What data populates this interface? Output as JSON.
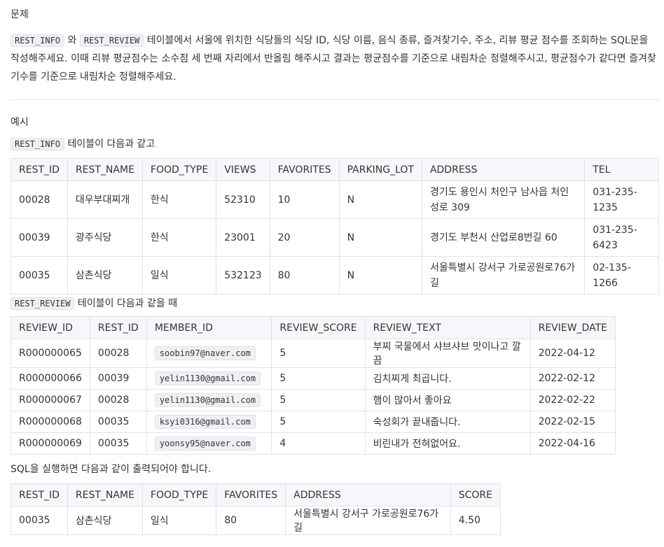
{
  "heading": "문제",
  "description": {
    "code1": "REST_INFO",
    "conj": " 와 ",
    "code2": "REST_REVIEW",
    "text": " 테이블에서 서울에 위치한 식당들의 식당 ID, 식당 이름, 음식 종류, 즐겨찾기수, 주소, 리뷰 평균 점수를 조회하는 SQL문을 작성해주세요. 이때 리뷰 평균점수는 소수점 세 번째 자리에서 반올림 해주시고 결과는 평균점수를 기준으로 내림차순 정렬해주시고, 평균점수가 같다면 즐겨찾기수를 기준으로 내림차순 정렬해주세요."
  },
  "example": {
    "heading": "예시",
    "caption1_code": "REST_INFO",
    "caption1_text": " 테이블이 다음과 같고",
    "caption2_code": "REST_REVIEW",
    "caption2_text": " 테이블이 다음과 같을 때",
    "caption3_text": "SQL을 실행하면 다음과 같이 출력되어야 합니다."
  },
  "rest_info": {
    "columns": [
      "REST_ID",
      "REST_NAME",
      "FOOD_TYPE",
      "VIEWS",
      "FAVORITES",
      "PARKING_LOT",
      "ADDRESS",
      "TEL"
    ],
    "rows": [
      [
        "00028",
        "대우부대찌개",
        "한식",
        "52310",
        "10",
        "N",
        "경기도 용인시 처인구 남사읍 처인성로 309",
        "031-235-1235"
      ],
      [
        "00039",
        "광주식당",
        "한식",
        "23001",
        "20",
        "N",
        "경기도 부천시 산업로8번길 60",
        "031-235-6423"
      ],
      [
        "00035",
        "삼촌식당",
        "일식",
        "532123",
        "80",
        "N",
        "서울특별시 강서구 가로공원로76가길",
        "02-135-1266"
      ]
    ]
  },
  "rest_review": {
    "columns": [
      "REVIEW_ID",
      "REST_ID",
      "MEMBER_ID",
      "REVIEW_SCORE",
      "REVIEW_TEXT",
      "REVIEW_DATE"
    ],
    "rows": [
      [
        "R000000065",
        "00028",
        "soobin97@naver.com",
        "5",
        "부찌 국물에서 샤브샤브 맛이나고 깔끔",
        "2022-04-12"
      ],
      [
        "R000000066",
        "00039",
        "yelin1130@gmail.com",
        "5",
        "김치찌게 최곱니다.",
        "2022-02-12"
      ],
      [
        "R000000067",
        "00028",
        "yelin1130@gmail.com",
        "5",
        "햄이 많아서 좋아요",
        "2022-02-22"
      ],
      [
        "R000000068",
        "00035",
        "ksyi0316@gmail.com",
        "5",
        "숙성회가 끝내줍니다.",
        "2022-02-15"
      ],
      [
        "R000000069",
        "00035",
        "yoonsy95@naver.com",
        "4",
        "비린내가 전혀없어요.",
        "2022-04-16"
      ]
    ]
  },
  "result": {
    "columns": [
      "REST_ID",
      "REST_NAME",
      "FOOD_TYPE",
      "FAVORITES",
      "ADDRESS",
      "SCORE"
    ],
    "rows": [
      [
        "00035",
        "삼촌식당",
        "일식",
        "80",
        "서울특별시 강서구 가로공원로76가길",
        "4.50"
      ]
    ]
  }
}
